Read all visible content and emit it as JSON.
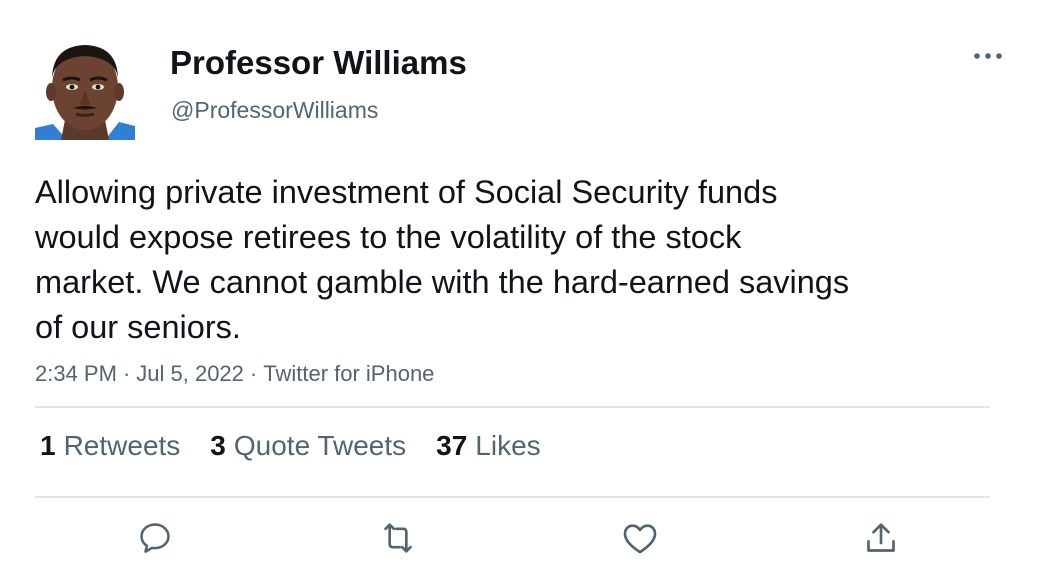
{
  "author": {
    "display_name": "Professor Williams",
    "handle": "@ProfessorWilliams"
  },
  "tweet": {
    "lines": [
      "Allowing private investment of Social Security funds",
      "would expose retirees to the volatility of the stock",
      "market. We cannot gamble with the hard-earned savings",
      "of our seniors."
    ],
    "time": "2:34 PM",
    "date": "Jul 5, 2022",
    "source": "Twitter for iPhone",
    "separator": "·"
  },
  "stats": {
    "retweets_count": "1",
    "retweets_label": "Retweets",
    "quotes_count": "3",
    "quotes_label": "Quote Tweets",
    "likes_count": "37",
    "likes_label": "Likes"
  },
  "actions": {
    "icons": [
      "reply-icon",
      "retweet-icon",
      "like-icon",
      "share-icon"
    ]
  },
  "colors": {
    "text_primary": "#0f1419",
    "text_secondary": "#536471",
    "icon": "#536471",
    "divider": "#e3e5e8"
  }
}
